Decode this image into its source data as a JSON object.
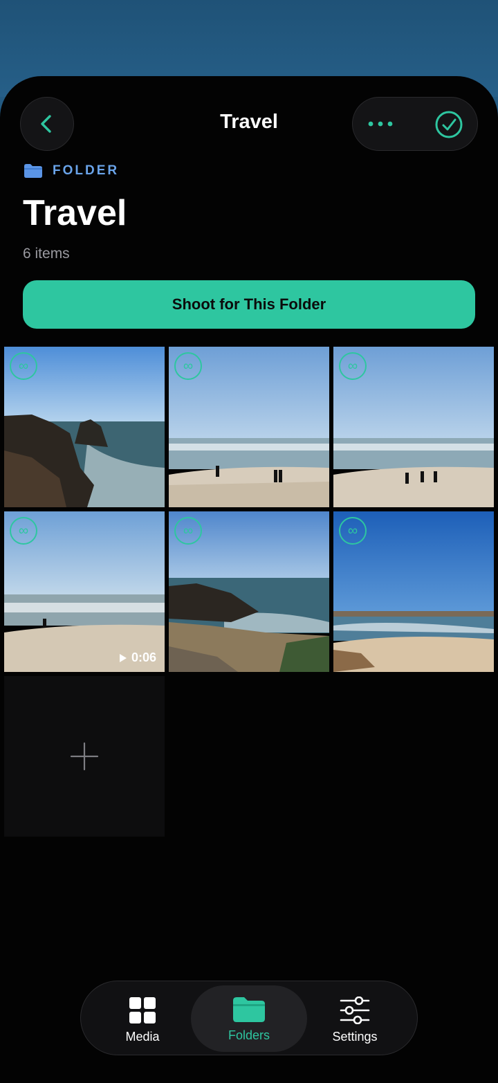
{
  "header": {
    "title": "Travel"
  },
  "folder": {
    "kicker": "FOLDER",
    "title": "Travel",
    "count": "6 items"
  },
  "actions": {
    "shoot_label": "Shoot for This Folder"
  },
  "grid": {
    "badge_symbol": "∞",
    "video_duration": "0:06"
  },
  "tabbar": {
    "media": "Media",
    "folders": "Folders",
    "settings": "Settings"
  },
  "colors": {
    "accent": "#2ec6a0",
    "kicker": "#6aa4ea",
    "background": "#030303"
  }
}
